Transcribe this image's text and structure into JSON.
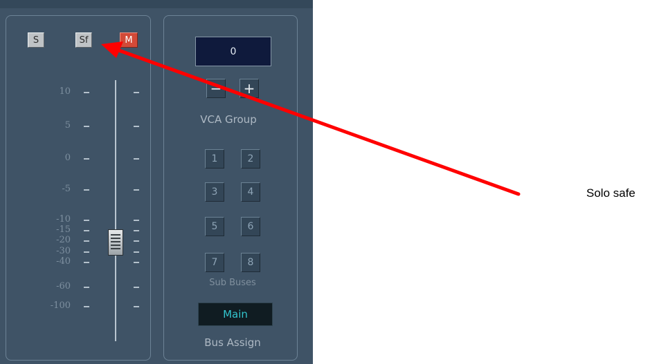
{
  "channel_strip": {
    "solo_label": "S",
    "solo_safe_label": "Sf",
    "mute_label": "M",
    "fader_scale": [
      "10",
      "5",
      "0",
      "-5",
      "-10",
      "-15",
      "-20",
      "-30",
      "-40",
      "-60",
      "-100"
    ]
  },
  "vca": {
    "value": "0",
    "minus_label": "−",
    "plus_label": "+",
    "group_label": "VCA Group"
  },
  "sub_buses": {
    "buttons": [
      "1",
      "2",
      "3",
      "4",
      "5",
      "6",
      "7",
      "8"
    ],
    "label": "Sub Buses"
  },
  "bus_assign": {
    "value": "Main",
    "label": "Bus Assign"
  },
  "annotation": {
    "text": "Solo safe"
  },
  "colors": {
    "console_bg": "#3f5366",
    "mute_red": "#d24a38",
    "arrow_red": "#ff0000",
    "main_text": "#33c6cf"
  }
}
